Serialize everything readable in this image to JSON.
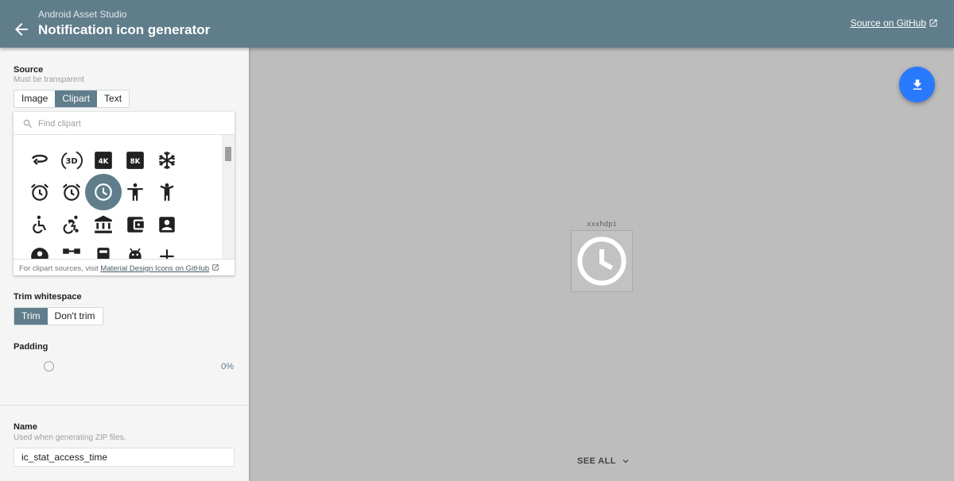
{
  "header": {
    "subtitle": "Android Asset Studio",
    "title": "Notification icon generator",
    "github_link": "Source on GitHub",
    "back_icon": "arrow-back-icon",
    "open_in_new_icon": "open-in-new-icon"
  },
  "sidebar": {
    "source": {
      "label": "Source",
      "hint": "Must be transparent",
      "tabs": [
        "Image",
        "Clipart",
        "Text"
      ],
      "selected_tab": "Clipart"
    },
    "clipart": {
      "search_placeholder": "Find clipart",
      "footer_text": "For clipart sources, visit",
      "footer_link": "Material Design Icons on GitHub",
      "selected_icon": "access-time-icon",
      "icons": [
        "3d-rotation-icon",
        "3d-icon",
        "4k-icon",
        "8k-icon",
        "ac-unit-icon",
        "access-alarm-icon",
        "access-alarms-icon",
        "access-time-icon",
        "accessibility-icon",
        "accessibility-new-icon",
        "accessible-icon",
        "accessible-forward-icon",
        "account-balance-icon",
        "account-balance-wallet-icon",
        "account-box-icon",
        "account-circle-icon",
        "account-tree-icon",
        "ad-units-icon",
        "adb-icon",
        "add-icon"
      ]
    },
    "trim": {
      "label": "Trim whitespace",
      "options": [
        "Trim",
        "Don't trim"
      ],
      "selected": "Trim"
    },
    "padding": {
      "label": "Padding",
      "value": "0%"
    },
    "name": {
      "label": "Name",
      "hint": "Used when generating ZIP files.",
      "value": "ic_stat_access_time"
    }
  },
  "preview": {
    "density": "xxxhdpi",
    "icon": "access-time-icon",
    "see_all": "SEE ALL",
    "download_icon": "download-icon"
  },
  "colors": {
    "appbar": "#607d8b",
    "fab": "#2979ff",
    "canvas": "#bdbdbd",
    "accent": "#607d8b"
  }
}
